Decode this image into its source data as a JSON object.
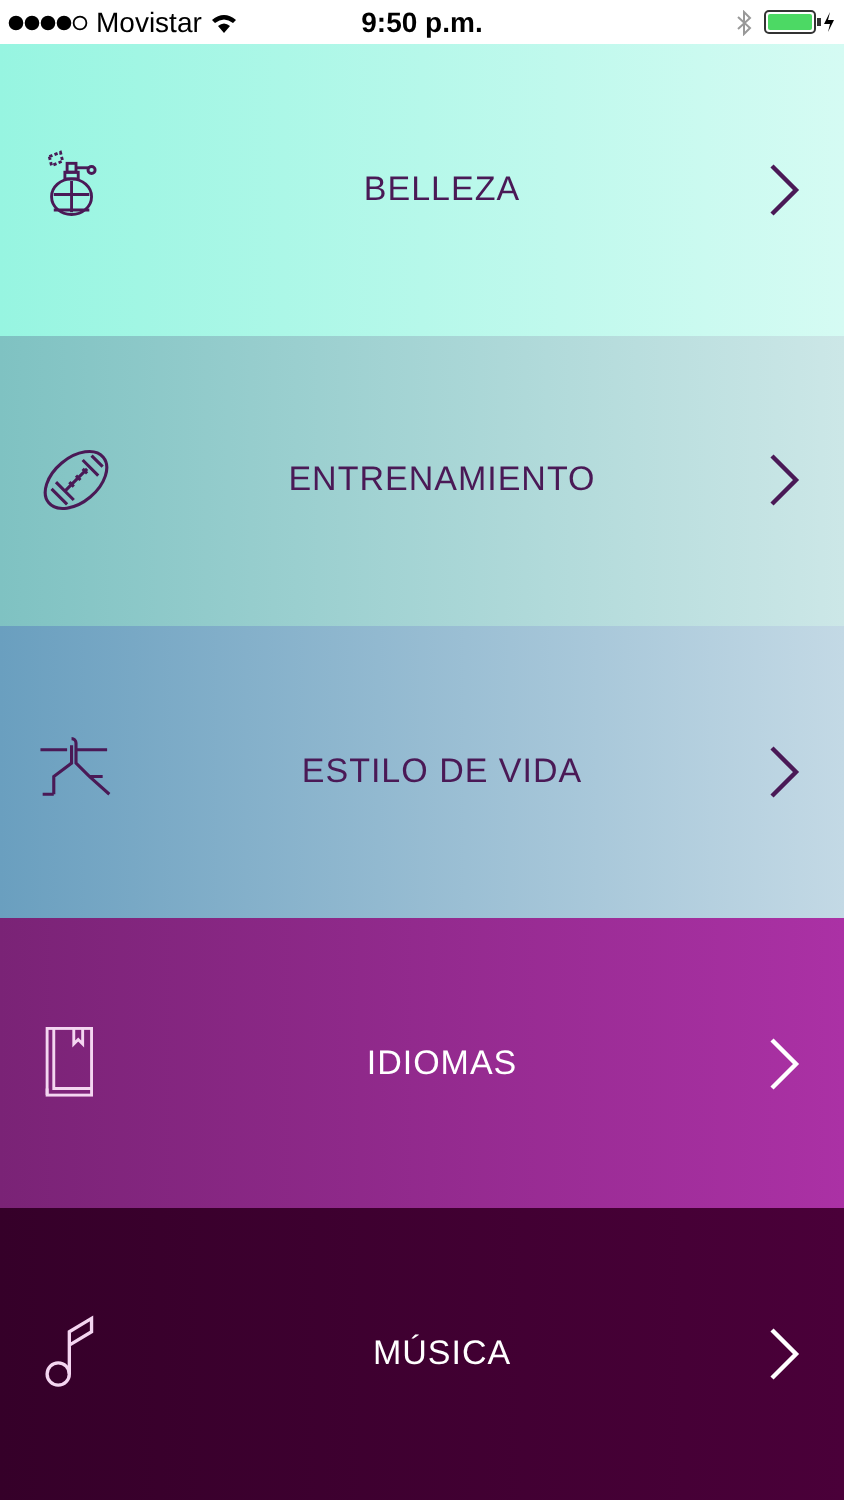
{
  "status_bar": {
    "carrier": "Movistar",
    "time": "9:50 p.m."
  },
  "categories": [
    {
      "label": "BELLEZA",
      "kind": "perfume",
      "color": "#97f5e1"
    },
    {
      "label": "ENTRENAMIENTO",
      "kind": "football",
      "color": "#7fc2c2"
    },
    {
      "label": "ESTILO DE VIDA",
      "kind": "yoga",
      "color": "#6a9fbf"
    },
    {
      "label": "IDIOMAS",
      "kind": "book",
      "color": "#7a2376"
    },
    {
      "label": "MÚSICA",
      "kind": "note",
      "color": "#350029"
    }
  ]
}
